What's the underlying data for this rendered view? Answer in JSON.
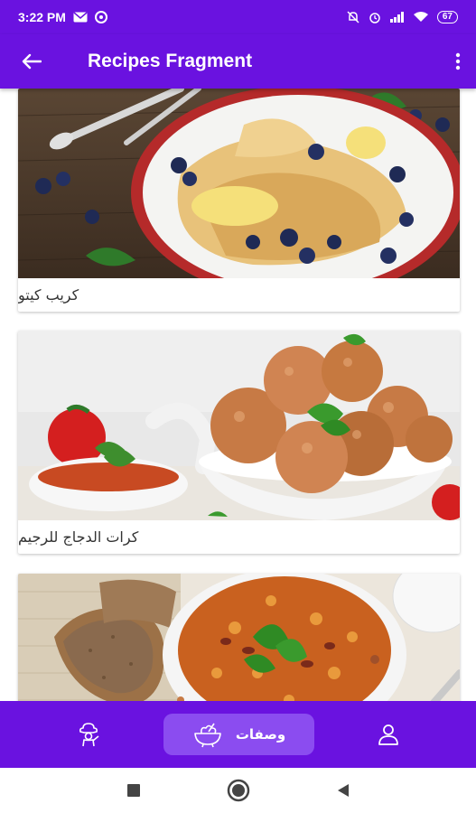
{
  "status_bar": {
    "time": "3:22 PM",
    "battery": "67",
    "icons_left": [
      "mail-icon",
      "app-icon"
    ],
    "icons_right": [
      "mute-icon",
      "alarm-icon",
      "signal-icon",
      "wifi-icon",
      "battery-icon"
    ]
  },
  "app_bar": {
    "title": "Recipes Fragment",
    "back_icon": "arrow-back-icon",
    "menu_icon": "more-vert-icon"
  },
  "recipes": [
    {
      "title": "كريب كيتو"
    },
    {
      "title": "كرات الدجاج للرجيم"
    },
    {
      "title": ""
    }
  ],
  "bottom_nav": {
    "items": [
      {
        "icon": "chef-icon"
      },
      {
        "icon": "food-bowl-icon",
        "label": "وصفات",
        "active": true
      },
      {
        "icon": "person-icon"
      }
    ]
  },
  "colors": {
    "primary": "#6a12e0",
    "nav_active": "#8b4cf0"
  }
}
